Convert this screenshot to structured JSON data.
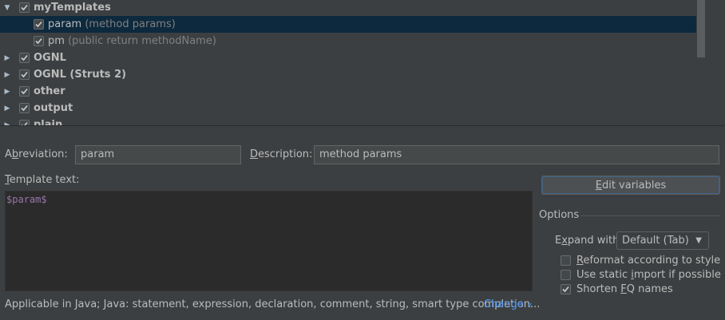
{
  "tree": {
    "groups": [
      {
        "label": "myTemplates",
        "expanded": true,
        "checked": true
      },
      {
        "label": "OGNL",
        "expanded": false,
        "checked": true
      },
      {
        "label": "OGNL (Struts 2)",
        "expanded": false,
        "checked": true
      },
      {
        "label": "other",
        "expanded": false,
        "checked": true
      },
      {
        "label": "output",
        "expanded": false,
        "checked": true
      },
      {
        "label": "plain",
        "expanded": false,
        "checked": true
      }
    ],
    "templates": [
      {
        "name": "param",
        "description": "(method params)",
        "checked": true,
        "selected": true
      },
      {
        "name": "pm",
        "description": "(public return methodName)",
        "checked": true,
        "selected": false
      }
    ]
  },
  "form": {
    "abbreviation_label_pre": "Ab",
    "abbreviation_label_key": "b",
    "abbreviation_label_post": "reviation:",
    "abbreviation_value": "param",
    "description_label_key": "D",
    "description_label_post": "escription:",
    "description_value": "method params",
    "template_text_label_key": "T",
    "template_text_label_post": "emplate text:",
    "template_text": "$param$"
  },
  "edit_variables": {
    "key": "E",
    "rest": "dit variables"
  },
  "options": {
    "title": "Options",
    "expand_with_pre": "E",
    "expand_with_key": "x",
    "expand_with_post": "pand with",
    "expand_with_value": "Default (Tab)",
    "checkboxes": [
      {
        "key": "R",
        "rest": "eformat according to style",
        "checked": false
      },
      {
        "pre": "Use static ",
        "key": "i",
        "rest": "mport if possible",
        "checked": false
      },
      {
        "pre": "Shorten ",
        "key": "F",
        "rest": "Q names",
        "checked": true
      }
    ]
  },
  "footer": {
    "applicable_text": "Applicable in Java; Java: statement, expression, declaration, comment, string, smart type completion...",
    "change_link": "Change"
  },
  "colors": {
    "background": "#3c3f41",
    "selection": "#0d293e",
    "link": "#589df6",
    "template_var": "#9876aa"
  }
}
